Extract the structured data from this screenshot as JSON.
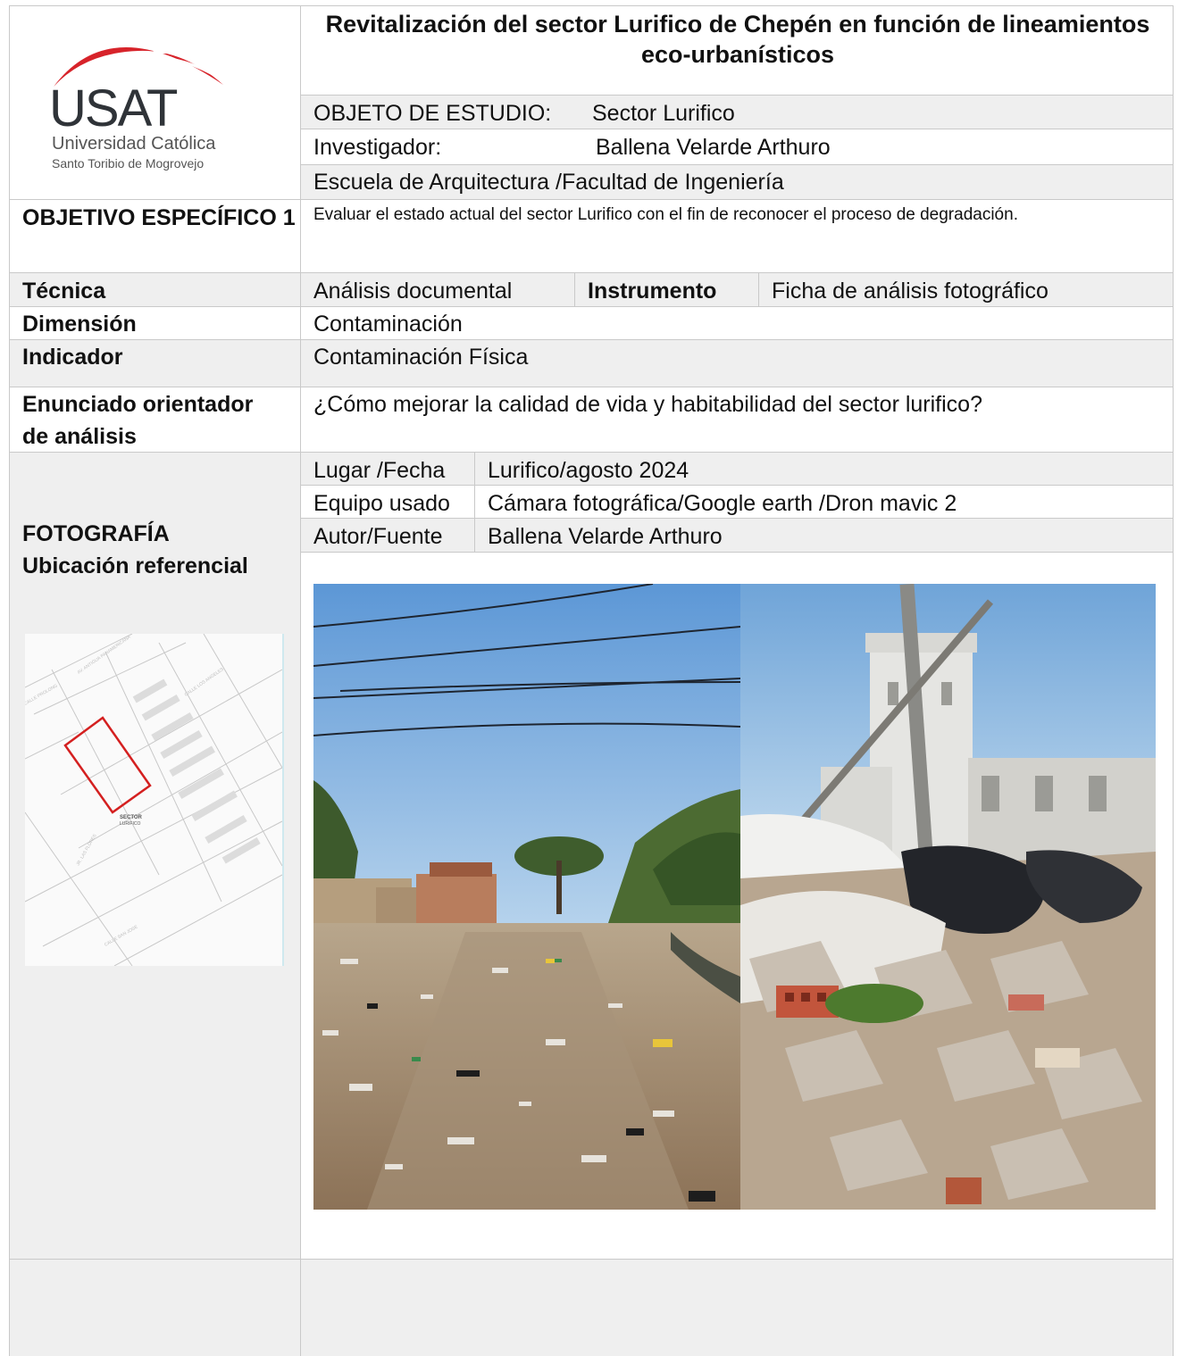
{
  "header": {
    "title": "Revitalización del sector Lurifico de Chepén en función de lineamientos eco-urbanísticos"
  },
  "logo": {
    "acronym": "USAT",
    "university": "Universidad Católica",
    "subtitle": "Santo Toribio de Mogrovejo",
    "arc_color": "#d7232a"
  },
  "info": {
    "objeto_label": "OBJETO DE ESTUDIO:",
    "objeto_value": "Sector Lurifico",
    "investigador_label": "Investigador:",
    "investigador_value": "Ballena Velarde Arthuro",
    "escuela": "Escuela de Arquitectura /Facultad de Ingeniería"
  },
  "objetivo": {
    "label": "OBJETIVO ESPECÍFICO 1",
    "text": "Evaluar el estado actual del sector Lurifico con el fin de reconocer el proceso de degradación."
  },
  "tecnica": {
    "label": "Técnica",
    "value": "Análisis documental",
    "instrumento_label": "Instrumento",
    "instrumento_value": "Ficha de análisis fotográfico"
  },
  "dimension": {
    "label": "Dimensión",
    "value": "Contaminación"
  },
  "indicador": {
    "label": "Indicador",
    "value": "Contaminación Física"
  },
  "enunciado": {
    "label_line1": "Enunciado orientador",
    "label_line2": "de análisis",
    "value": "¿Cómo mejorar la calidad de vida y habitabilidad del sector lurifico?"
  },
  "foto": {
    "label_line1": "FOTOGRAFÍA",
    "label_line2": "Ubicación referencial",
    "lugar_label": "Lugar /Fecha",
    "lugar_value": "Lurifico/agosto 2024",
    "equipo_label": "Equipo usado",
    "equipo_value": "Cámara fotográfica/Google earth /Dron mavic 2",
    "autor_label": "Autor/Fuente",
    "autor_value": "Ballena Velarde Arthuro"
  },
  "map": {
    "sector_label_line1": "SECTOR",
    "sector_label_line2": "LURIFICO",
    "highlight_color": "#d42020"
  }
}
